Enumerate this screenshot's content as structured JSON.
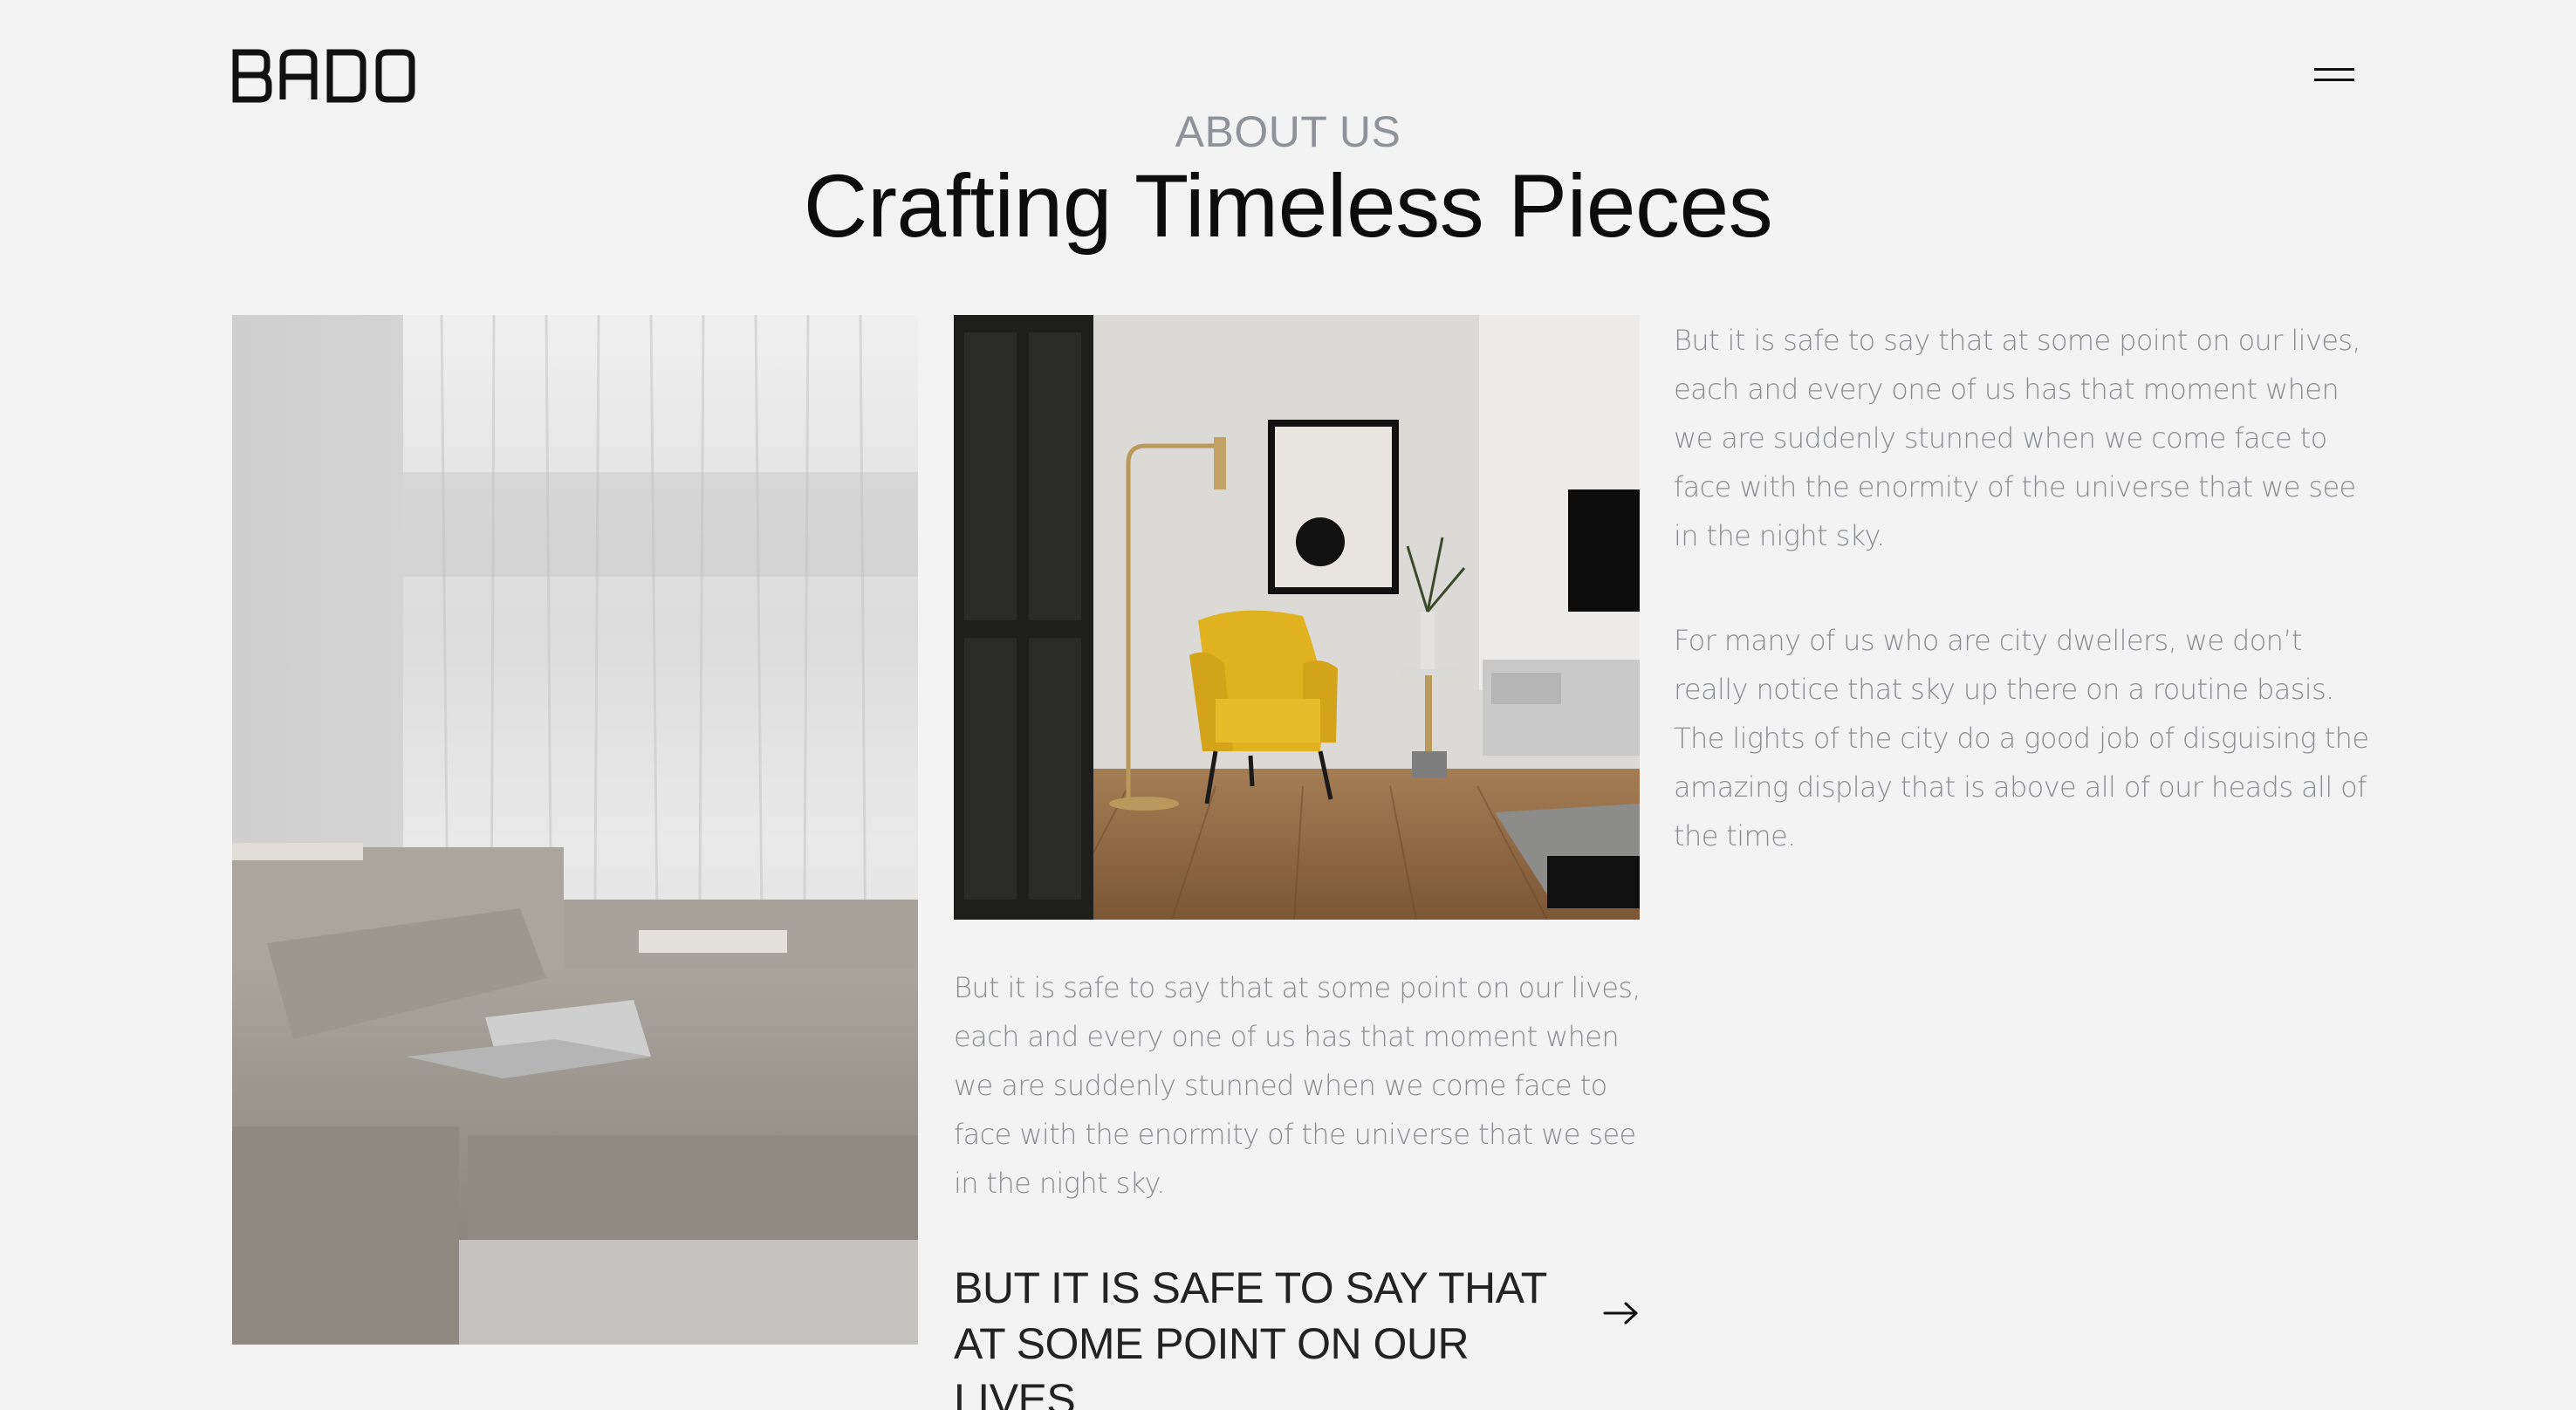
{
  "header": {
    "logo": "BADO",
    "menu_icon": "hamburger-menu-icon"
  },
  "section": {
    "eyebrow": "ABOUT US",
    "title": "Crafting Timeless Pieces"
  },
  "images": {
    "left": "sofa-with-curtains-photo",
    "middle": "yellow-armchair-living-room-photo"
  },
  "column_right": {
    "paragraph_1": "But it is safe to say that at some point on our lives, each and every one of us has that moment when we are suddenly stunned when we come face to face with the enormity of the universe that we see in the night sky.",
    "paragraph_2": "For many of us who are city dwellers, we don’t really notice that sky up there on a routine basis. The lights of the city do a good job of disguising the amazing display that is above all of our heads all of the time."
  },
  "column_middle": {
    "paragraph": "But it is safe to say that at some point on our lives, each and every one of us has that moment when we are suddenly stunned when we come face to face with the enormity of the universe that we see in the night sky.",
    "cta": "BUT IT IS SAFE TO SAY THAT AT SOME POINT ON OUR LIVES",
    "cta_icon": "arrow-right-icon"
  },
  "colors": {
    "background": "#f3f3f3",
    "text_dark": "#111111",
    "text_muted": "#8a8c90",
    "eyebrow": "#8f9399",
    "chair_yellow": "#e0b21f"
  }
}
